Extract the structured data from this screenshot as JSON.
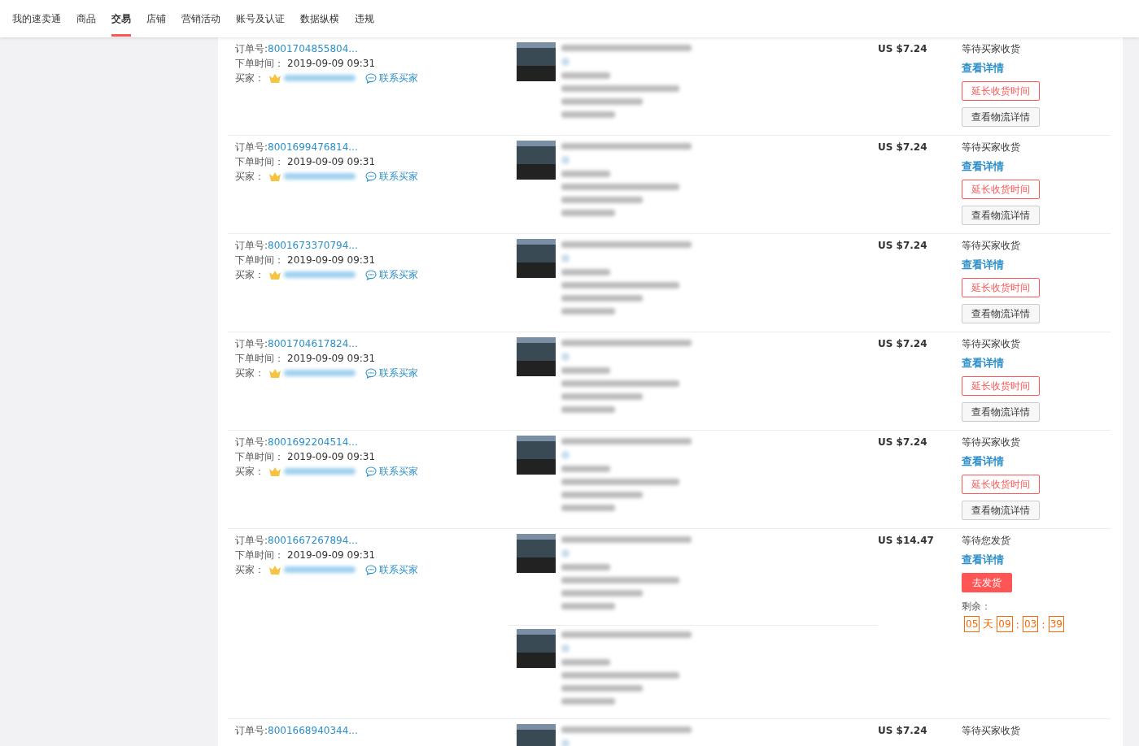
{
  "nav": [
    {
      "label": "我的速卖通",
      "selected": false
    },
    {
      "label": "商品",
      "selected": false
    },
    {
      "label": "交易",
      "selected": true
    },
    {
      "label": "店铺",
      "selected": false
    },
    {
      "label": "营销活动",
      "selected": false
    },
    {
      "label": "账号及认证",
      "selected": false
    },
    {
      "label": "数据纵横",
      "selected": false
    },
    {
      "label": "违规",
      "selected": false
    }
  ],
  "orders": [
    {
      "order_label": "订单号:",
      "order_no": "8001704855804...",
      "time_label": "下单时间：",
      "time": "2019-09-09 09:31",
      "buyer_label": "买家：",
      "contact": "联系买家",
      "products": [
        {
          "kind": "blurred"
        }
      ],
      "price": "US $7.24",
      "status": "等待买家收货",
      "actions": [
        {
          "kind": "link",
          "label": "查看详情"
        },
        {
          "kind": "outline-red",
          "label": "延长收货时间"
        },
        {
          "kind": "default",
          "label": "查看物流详情"
        }
      ]
    },
    {
      "order_label": "订单号:",
      "order_no": "8001699476814...",
      "time_label": "下单时间：",
      "time": "2019-09-09 09:31",
      "buyer_label": "买家：",
      "contact": "联系买家",
      "products": [
        {
          "kind": "blurred"
        }
      ],
      "price": "US $7.24",
      "status": "等待买家收货",
      "actions": [
        {
          "kind": "link",
          "label": "查看详情"
        },
        {
          "kind": "outline-red",
          "label": "延长收货时间"
        },
        {
          "kind": "default",
          "label": "查看物流详情"
        }
      ]
    },
    {
      "order_label": "订单号:",
      "order_no": "8001673370794...",
      "time_label": "下单时间：",
      "time": "2019-09-09 09:31",
      "buyer_label": "买家：",
      "contact": "联系买家",
      "products": [
        {
          "kind": "blurred"
        }
      ],
      "price": "US $7.24",
      "status": "等待买家收货",
      "actions": [
        {
          "kind": "link",
          "label": "查看详情"
        },
        {
          "kind": "outline-red",
          "label": "延长收货时间"
        },
        {
          "kind": "default",
          "label": "查看物流详情"
        }
      ]
    },
    {
      "order_label": "订单号:",
      "order_no": "8001704617824...",
      "time_label": "下单时间：",
      "time": "2019-09-09 09:31",
      "buyer_label": "买家：",
      "contact": "联系买家",
      "products": [
        {
          "kind": "blurred"
        }
      ],
      "price": "US $7.24",
      "status": "等待买家收货",
      "actions": [
        {
          "kind": "link",
          "label": "查看详情"
        },
        {
          "kind": "outline-red",
          "label": "延长收货时间"
        },
        {
          "kind": "default",
          "label": "查看物流详情"
        }
      ]
    },
    {
      "order_label": "订单号:",
      "order_no": "8001692204514...",
      "time_label": "下单时间：",
      "time": "2019-09-09 09:31",
      "buyer_label": "买家：",
      "contact": "联系买家",
      "products": [
        {
          "kind": "blurred"
        }
      ],
      "price": "US $7.24",
      "status": "等待买家收货",
      "actions": [
        {
          "kind": "link",
          "label": "查看详情"
        },
        {
          "kind": "outline-red",
          "label": "延长收货时间"
        },
        {
          "kind": "default",
          "label": "查看物流详情"
        }
      ]
    },
    {
      "order_label": "订单号:",
      "order_no": "8001667267894...",
      "time_label": "下单时间：",
      "time": "2019-09-09 09:31",
      "buyer_label": "买家：",
      "contact": "联系买家",
      "products": [
        {
          "kind": "blurred"
        },
        {
          "kind": "blurred"
        }
      ],
      "price": "US $14.47",
      "status": "等待您发货",
      "actions": [
        {
          "kind": "link",
          "label": "查看详情"
        },
        {
          "kind": "primary",
          "label": "去发货"
        }
      ],
      "countdown": {
        "label": "剩余：",
        "parts": [
          {
            "kind": "box",
            "text": "05"
          },
          {
            "kind": "sep",
            "text": "天"
          },
          {
            "kind": "box",
            "text": "09"
          },
          {
            "kind": "sep",
            "text": ":"
          },
          {
            "kind": "box",
            "text": "03"
          },
          {
            "kind": "sep",
            "text": ":"
          },
          {
            "kind": "box",
            "text": "39"
          }
        ]
      }
    },
    {
      "order_label": "订单号:",
      "order_no": "8001668940344...",
      "products": [
        {
          "kind": "blurred"
        }
      ],
      "price": "US $7.24",
      "status": "等待买家收货"
    }
  ]
}
